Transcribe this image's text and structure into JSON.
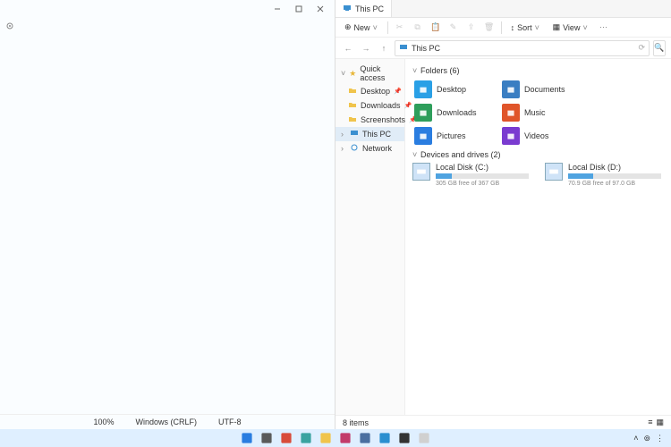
{
  "left_window": {
    "status": {
      "zoom": "100%",
      "encoding": "Windows (CRLF)",
      "charset": "UTF-8"
    }
  },
  "explorer": {
    "tab_title": "This PC",
    "toolbar": {
      "new": "New",
      "sort": "Sort",
      "view": "View"
    },
    "address": "This PC",
    "sidebar": {
      "quick_access": "Quick access",
      "items": [
        {
          "label": "Desktop"
        },
        {
          "label": "Downloads"
        },
        {
          "label": "Screenshots"
        }
      ],
      "this_pc": "This PC",
      "network": "Network"
    },
    "sections": {
      "folders_header": "Folders (6)",
      "folders": [
        {
          "label": "Desktop",
          "color": "#2aa0e6"
        },
        {
          "label": "Documents",
          "color": "#3a7ec2"
        },
        {
          "label": "Downloads",
          "color": "#2e9e5b"
        },
        {
          "label": "Music",
          "color": "#e0552a"
        },
        {
          "label": "Pictures",
          "color": "#2a7de0"
        },
        {
          "label": "Videos",
          "color": "#7a3bd0"
        }
      ],
      "drives_header": "Devices and drives (2)",
      "drives": [
        {
          "label": "Local Disk (C:)",
          "free_text": "305 GB free of 367 GB",
          "fill_pct": 17
        },
        {
          "label": "Local Disk (D:)",
          "free_text": "70.9 GB free of 97.0 GB",
          "fill_pct": 27
        }
      ]
    },
    "status": "8 items"
  },
  "taskbar": {
    "apps": [
      {
        "name": "start",
        "color": "#2a7de0"
      },
      {
        "name": "search",
        "color": "#5a5a5a"
      },
      {
        "name": "chrome",
        "color": "#d84b3a"
      },
      {
        "name": "iris",
        "color": "#3aa3a0"
      },
      {
        "name": "explorer",
        "color": "#f0c44c"
      },
      {
        "name": "slack",
        "color": "#c23b6a"
      },
      {
        "name": "settings",
        "color": "#4a6fa0"
      },
      {
        "name": "vscode",
        "color": "#2a8fd0"
      },
      {
        "name": "terminal",
        "color": "#333333"
      },
      {
        "name": "notepad",
        "color": "#d0d0d0"
      }
    ]
  }
}
